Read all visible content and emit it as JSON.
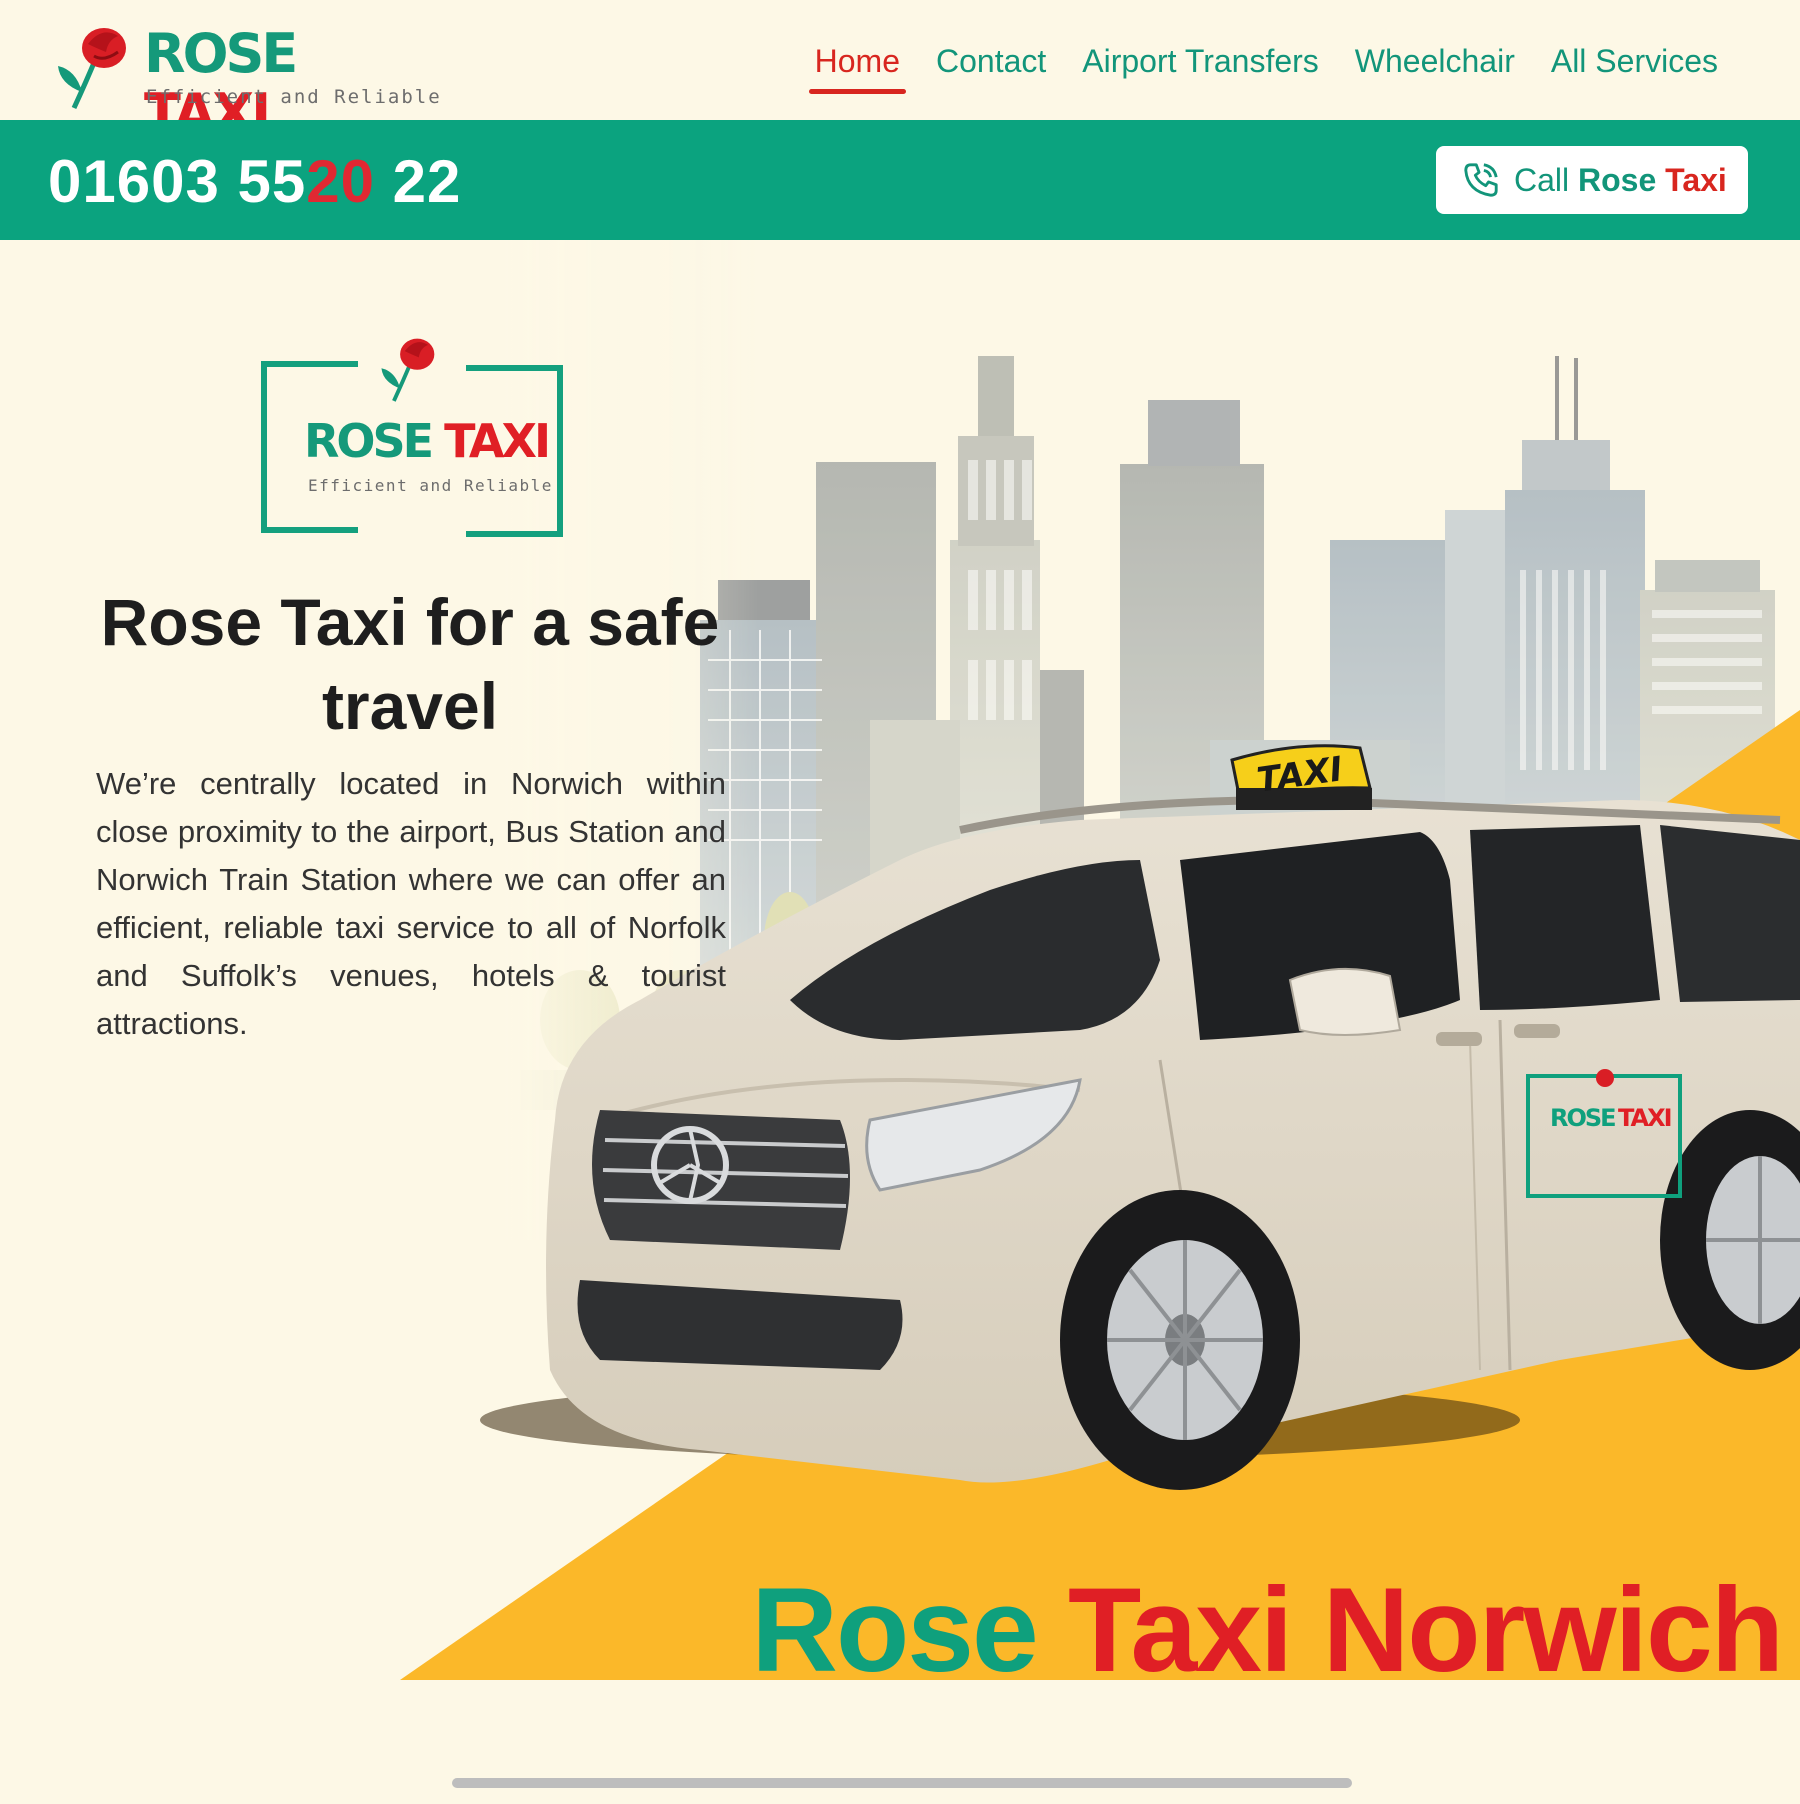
{
  "header": {
    "logo": {
      "word1": "ROSE",
      "word2": "TAXI",
      "tagline": "Efficient and Reliable"
    },
    "nav": [
      {
        "label": "Home",
        "active": true
      },
      {
        "label": "Contact",
        "active": false
      },
      {
        "label": "Airport Transfers",
        "active": false
      },
      {
        "label": "Wheelchair",
        "active": false
      },
      {
        "label": "All Services",
        "active": false
      }
    ]
  },
  "phonebar": {
    "number_part1": "01603 55",
    "number_highlight": "20",
    "number_part2": " 22",
    "call_button": {
      "prefix": "Call ",
      "word1": "Rose",
      "word2": " Taxi",
      "icon": "phone-icon"
    }
  },
  "hero": {
    "brand_box": {
      "word1": "ROSE",
      "word2": "TAXI",
      "tagline": "Efficient and Reliable"
    },
    "heading": "Rose Taxi for a safe travel",
    "paragraph": "We’re centrally located in Norwich within close proximity to the airport, Bus Station and Norwich Train Station where we can offer an efficient, reliable taxi service to all of Norfolk and Suffolk’s venues, hotels & tourist attractions.",
    "taxi_sign": "TAXI",
    "van_logo_word1": "ROSE",
    "van_logo_word2": "TAXI",
    "bottom_title_word1": "Rose",
    "bottom_title_word2": " Taxi Norwich"
  },
  "colors": {
    "background": "#fdf8e6",
    "green": "#0ba37f",
    "red": "#e01f25",
    "yellow": "#fbb829"
  }
}
